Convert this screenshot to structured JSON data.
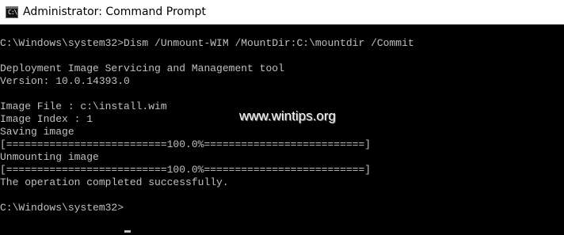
{
  "window": {
    "title": "Administrator: Command Prompt",
    "icon": "command-prompt-icon",
    "icon_text": "C:\\"
  },
  "console": {
    "text_color": "#c0c0c0",
    "background_color": "#000000",
    "lines": [
      "C:\\Windows\\system32>Dism /Unmount-WIM /MountDir:C:\\mountdir /Commit",
      "Deployment Image Servicing and Management tool",
      "Version: 10.0.14393.0",
      "Image File : c:\\install.wim",
      "Image Index : 1",
      "Saving image",
      "[==========================100.0%==========================]",
      "Unmounting image",
      "[==========================100.0%==========================]",
      "The operation completed successfully.",
      "C:\\Windows\\system32>"
    ],
    "progress": {
      "saving_image_percent": "100.0%",
      "unmounting_image_percent": "100.0%"
    }
  },
  "watermark": {
    "text": "www.wintips.org"
  }
}
